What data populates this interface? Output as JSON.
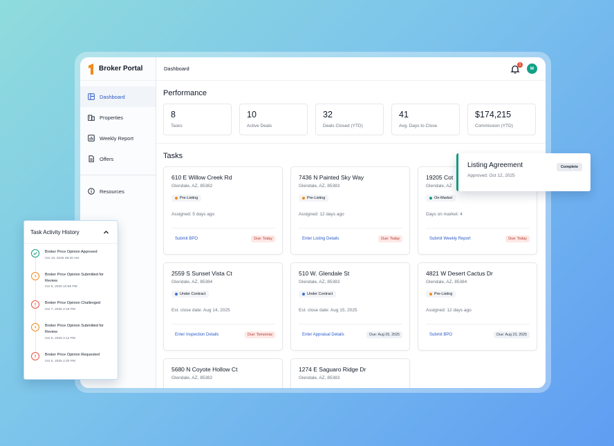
{
  "sidebar": {
    "brand": "Broker Portal",
    "items": [
      {
        "label": "Dashboard",
        "icon": "dashboard-icon"
      },
      {
        "label": "Properties",
        "icon": "building-icon"
      },
      {
        "label": "Weekly Report",
        "icon": "chart-icon"
      },
      {
        "label": "Offers",
        "icon": "document-icon"
      },
      {
        "label": "Resources",
        "icon": "info-icon"
      }
    ]
  },
  "header": {
    "breadcrumb": "Dashboard",
    "notification_count": "1",
    "avatar_initial": "M"
  },
  "performance": {
    "title": "Performance",
    "stats": [
      {
        "value": "8",
        "label": "Tasks"
      },
      {
        "value": "10",
        "label": "Active Deals"
      },
      {
        "value": "32",
        "label": "Deals Closed (YTD)"
      },
      {
        "value": "41",
        "label": "Avg. Days to Close"
      },
      {
        "value": "$174,215",
        "label": "Commission (YTD)"
      }
    ]
  },
  "tasks": {
    "title": "Tasks",
    "cards": [
      {
        "title": "610 E Willow Creek Rd",
        "address": "Glendale, AZ, 85382",
        "tag": "Pre-Listing",
        "meta": "Assigned: 5 days ago",
        "action": "Submit BPO",
        "due": "Due: Today"
      },
      {
        "title": "7436 N Painted Sky Way",
        "address": "Glendale, AZ, 85383",
        "tag": "Pre-Listing",
        "meta": "Assigned: 12 days ago",
        "action": "Enter Listing Details",
        "due": "Due: Today"
      },
      {
        "title": "19205 Cot",
        "address": "Glendale, AZ",
        "tag": "On-Market",
        "meta": "Days on market: 4",
        "action": "Submit Weekly Report",
        "due": "Due: Today"
      },
      {
        "title": "2559 S Sunset Vista Ct",
        "address": "Glendale, AZ, 85384",
        "tag": "Under Contract",
        "meta": "Est. close date: Aug 14, 2025",
        "action": "Enter Inspection Details",
        "due": "Due: Tomorrow"
      },
      {
        "title": "510 W. Glendale St",
        "address": "Glendale, AZ, 85383",
        "tag": "Under Contract",
        "meta": "Est. close date: Aug 15, 2025",
        "action": "Enter Appraisal Details",
        "due": "Due: Aug 05, 2025"
      },
      {
        "title": "4821 W Desert Cactus Dr",
        "address": "Glendale, AZ, 85384",
        "tag": "Pre-Listing",
        "meta": "Assigned: 12 days ago",
        "action": "Submit BPO",
        "due": "Due: Aug 23, 2025"
      },
      {
        "title": "5680 N Coyote Hollow Ct",
        "address": "Glendale, AZ, 85382"
      },
      {
        "title": "1274 E Saguaro Ridge Dr",
        "address": "Glendale, AZ, 85383"
      }
    ]
  },
  "listing_agreement": {
    "title": "Listing Agreement",
    "subtitle": "Approved: Oct 12, 2025",
    "badge": "Complete"
  },
  "history": {
    "title": "Task Activity History",
    "items": [
      {
        "name": "Broker Price Opinion Approved",
        "time": "Oct 10, 2025 08:20 AM"
      },
      {
        "name": "Broker Price Opinion Submitted for Review",
        "time": "Oct 8, 2025 10:55 PM"
      },
      {
        "name": "Broker Price Opinion Challenged",
        "time": "Oct 7, 2025 2:18 PM"
      },
      {
        "name": "Broker Price Opinion Submitted for Review",
        "time": "Oct 6, 2025 4:12 PM"
      },
      {
        "name": "Broker Price Opinion Requested",
        "time": "Oct 5, 2025 2:30 PM"
      }
    ]
  },
  "colors": {
    "accent": "#2a59c7",
    "brand_orange": "#f08a1c",
    "pre_listing": "#f08a1c",
    "on_market": "#129a7e",
    "under_contract": "#3b6fd6",
    "alert_red": "#e5533c"
  }
}
